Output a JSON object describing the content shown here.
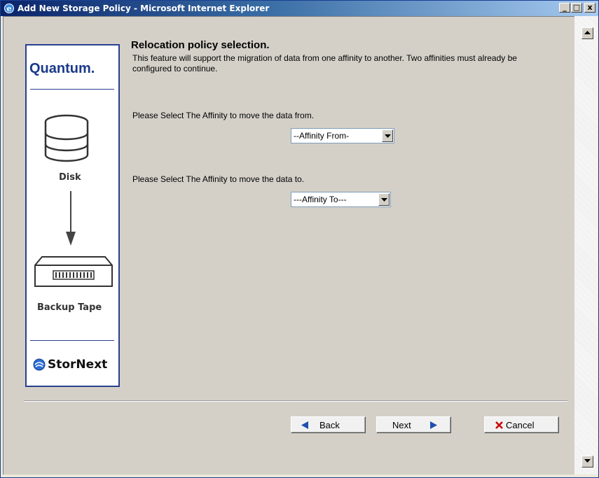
{
  "window": {
    "title": "Add New Storage Policy - Microsoft Internet Explorer",
    "minimize": "_",
    "maximize": "□",
    "close": "x"
  },
  "sidebar": {
    "brand_top": "Quantum.",
    "disk_label": "Disk",
    "tape_label": "Backup Tape",
    "brand_bottom": "StorNext",
    "icons": [
      "disk-icon",
      "down-arrow-icon",
      "tape-icon",
      "stornext-logo-icon"
    ]
  },
  "main": {
    "heading": "Relocation policy selection.",
    "description": "This feature will support the migration of data from one affinity to another. Two affinities must already be configured to continue.",
    "from_prompt": "Please Select The Affinity to move the data from.",
    "from_select": "--Affinity From-",
    "to_prompt": "Please Select The Affinity to move the data to.",
    "to_select": "---Affinity To---"
  },
  "buttons": {
    "back": "Back",
    "next": "Next",
    "cancel": "Cancel"
  },
  "colors": {
    "sidebar_border": "#2a3f8f",
    "quantum_blue": "#1a3a8a",
    "nav_arrow": "#1e4fb0",
    "cancel_x": "#cc0000"
  }
}
